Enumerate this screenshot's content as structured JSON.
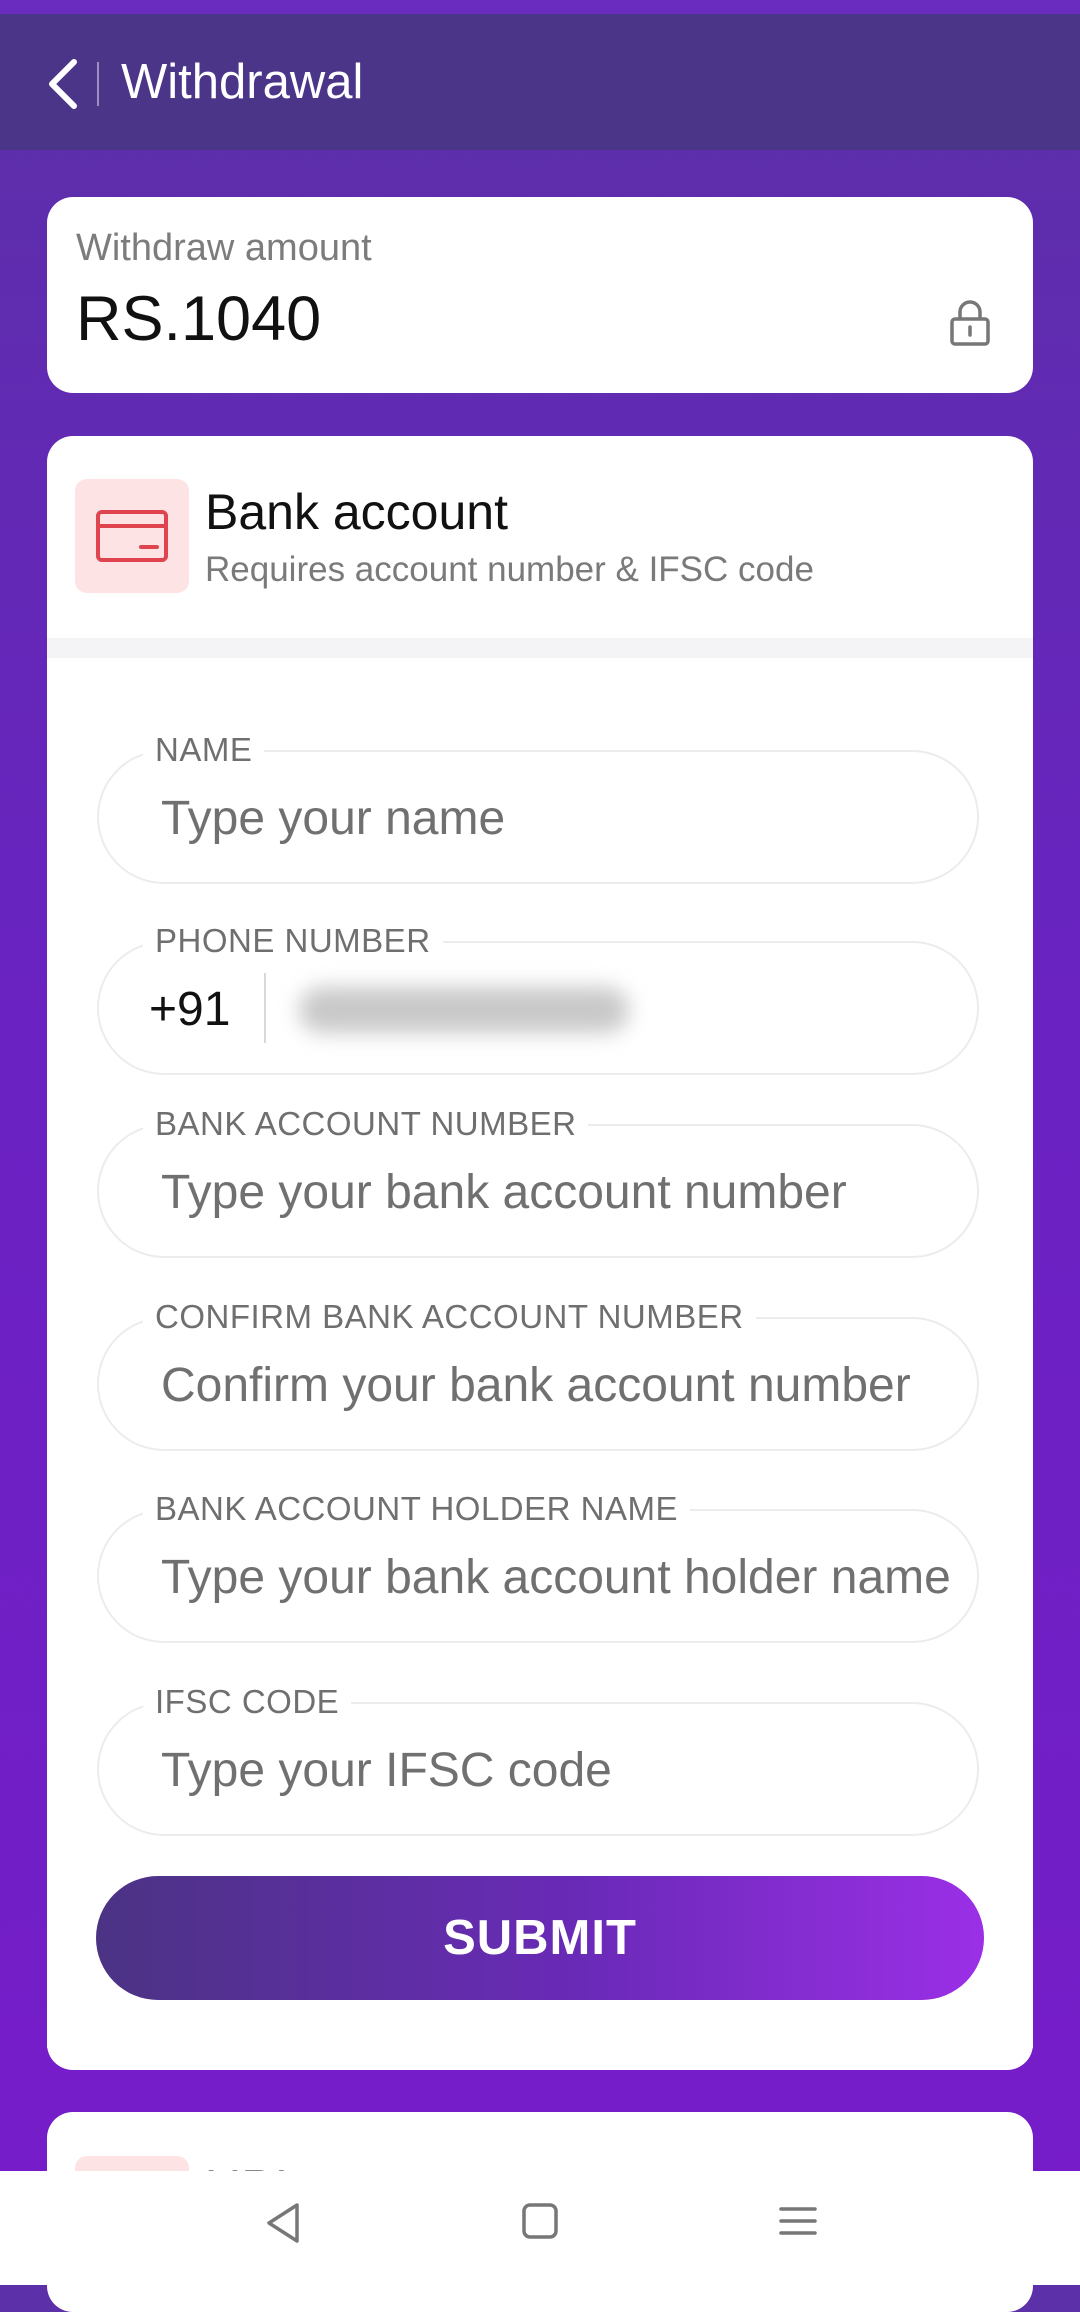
{
  "header": {
    "title": "Withdrawal"
  },
  "amount": {
    "label": "Withdraw amount",
    "value": "RS.1040"
  },
  "bank": {
    "title": "Bank account",
    "subtitle": "Requires account number & IFSC code",
    "fields": {
      "name": {
        "label": "NAME",
        "placeholder": "Type your name"
      },
      "phone": {
        "label": "PHONE NUMBER",
        "prefix": "+91"
      },
      "account": {
        "label": "BANK ACCOUNT NUMBER",
        "placeholder": "Type your bank account number"
      },
      "confirm": {
        "label": "CONFIRM BANK ACCOUNT NUMBER",
        "placeholder": "Confirm your bank account number"
      },
      "holder": {
        "label": "BANK ACCOUNT HOLDER NAME",
        "placeholder": "Type your bank account holder name"
      },
      "ifsc": {
        "label": "IFSC CODE",
        "placeholder": "Type your IFSC code"
      }
    },
    "submit_label": "SUBMIT"
  },
  "upi": {
    "title": "UPI"
  },
  "icons": {
    "back": "chevron-left-icon",
    "lock": "lock-icon",
    "card": "credit-card-icon",
    "nav_back": "triangle-back-icon",
    "nav_home": "square-home-icon",
    "nav_menu": "menu-icon"
  },
  "colors": {
    "accent": "#6a22c2",
    "header": "#4a3589",
    "card_icon": "#e0454f"
  }
}
